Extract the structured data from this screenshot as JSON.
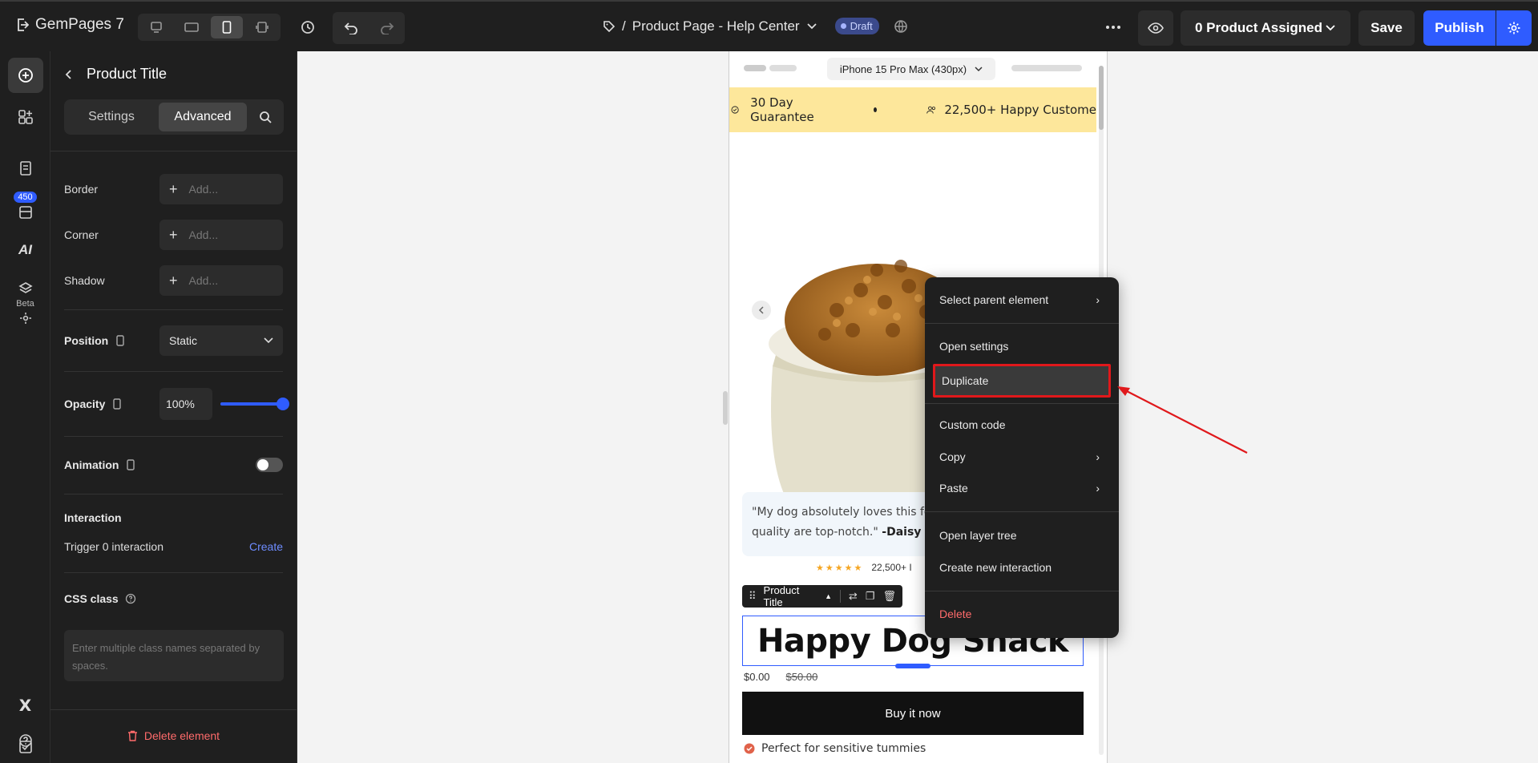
{
  "app": {
    "name": "GemPages 7"
  },
  "header": {
    "breadcrumb_sep": "/",
    "page_name": "Product Page - Help Center",
    "status": "Draft",
    "product_assigned": "0 Product Assigned",
    "save_label": "Save",
    "publish_label": "Publish"
  },
  "rail": {
    "badge": "450",
    "beta": "Beta"
  },
  "panel": {
    "title": "Product Title",
    "tabs": {
      "settings": "Settings",
      "advanced": "Advanced"
    },
    "border_label": "Border",
    "corner_label": "Corner",
    "shadow_label": "Shadow",
    "add_placeholder": "Add...",
    "position_label": "Position",
    "position_value": "Static",
    "opacity_label": "Opacity",
    "opacity_value": "100%",
    "opacity_fraction": 1.0,
    "animation_label": "Animation",
    "animation_enabled": false,
    "interaction_heading": "Interaction",
    "interaction_text": "Trigger 0 interaction",
    "create_label": "Create",
    "css_class_label": "CSS class",
    "css_placeholder": "Enter multiple class names separated by spaces.",
    "delete_label": "Delete element"
  },
  "canvas": {
    "device_label": "iPhone 15 Pro Max (430px)",
    "marquee_1": "30 Day Guarantee",
    "marquee_2": "22,500+ Happy Custome",
    "review_line1": "\"My dog absolutely loves this food",
    "review_line2": "quality are top-notch.\"",
    "review_author": "-Daisy",
    "rating_text": "22,500+ I",
    "toolbar_label": "Product Title",
    "product_title": "Happy Dog Snack",
    "price": "$0.00",
    "compare_price": "$50.00",
    "buy_label": "Buy it now",
    "benefit": "Perfect for sensitive tummies"
  },
  "context_menu": {
    "select_parent": "Select parent element",
    "open_settings": "Open settings",
    "duplicate": "Duplicate",
    "custom_code": "Custom code",
    "copy": "Copy",
    "paste": "Paste",
    "open_layer_tree": "Open layer tree",
    "create_interaction": "Create new interaction",
    "delete": "Delete"
  },
  "colors": {
    "accent": "#2f5cff",
    "marquee_bg": "#fde79b",
    "danger": "#ff6b6b",
    "highlight": "#e0181b"
  }
}
